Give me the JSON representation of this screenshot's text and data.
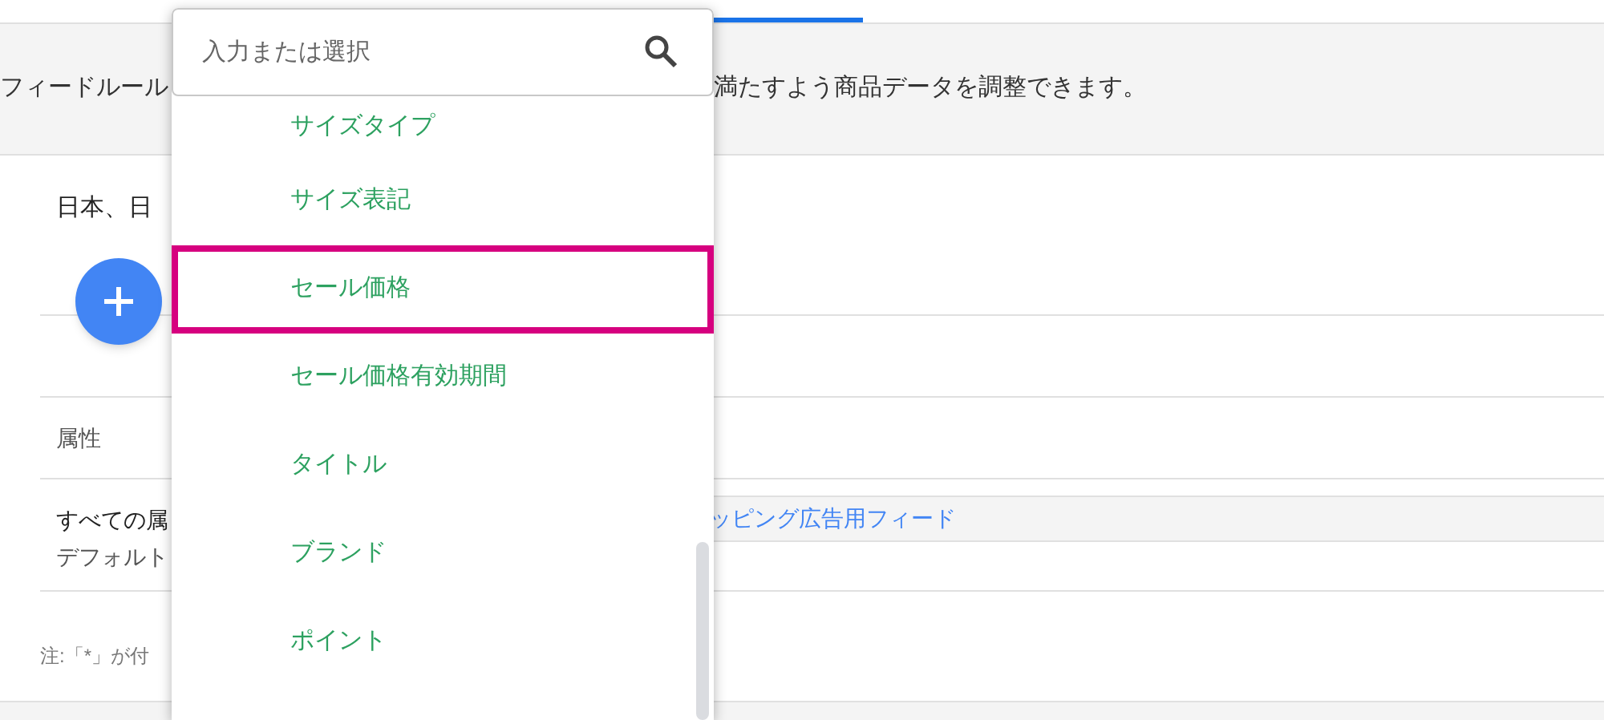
{
  "header": {
    "description_start": "フィードルール",
    "description_end": "満たすよう商品データを調整できます。"
  },
  "content": {
    "country_label": "日本、日",
    "table_header": "属性",
    "row_line_1": "すべての属",
    "row_line_2": "デフォルト",
    "feed_link": "ッピング広告用フィード",
    "note": "注:「*」が付"
  },
  "dropdown": {
    "search": {
      "placeholder": "入力または選択"
    },
    "items": [
      {
        "label": "サイズタイプ",
        "selected": false
      },
      {
        "label": "サイズ表記",
        "selected": false
      },
      {
        "label": "セール価格",
        "selected": true
      },
      {
        "label": "セール価格有効期間",
        "selected": false
      },
      {
        "label": "タイトル",
        "selected": false
      },
      {
        "label": "ブランド",
        "selected": false
      },
      {
        "label": "ポイント",
        "selected": false
      }
    ]
  }
}
